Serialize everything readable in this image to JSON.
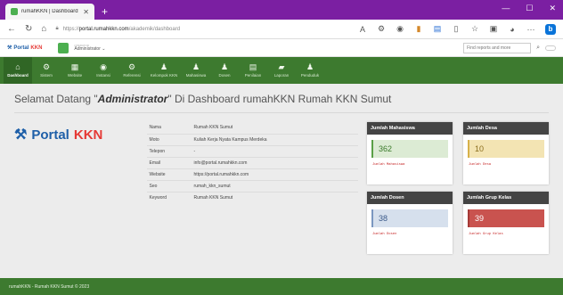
{
  "browser": {
    "tab_title": "rumahKKN | Dashboard",
    "new_tab": "+",
    "url_prefix": "https://",
    "url_host": "portal.rumahkkn.com",
    "url_path": "/akademik/dashboard"
  },
  "header": {
    "logo_portal": "Portal",
    "logo_kkn": "KKN",
    "user_role": "OPERATOR",
    "user_name": "Administrator",
    "search_placeholder": "Find reports and more"
  },
  "menu": [
    {
      "label": "Dashboard",
      "icon": "home-icon",
      "glyph": "⌂"
    },
    {
      "label": "Sistem",
      "icon": "gears-icon",
      "glyph": "⚙"
    },
    {
      "label": "Website",
      "icon": "chart-icon",
      "glyph": "▦"
    },
    {
      "label": "Instansi",
      "icon": "globe-icon",
      "glyph": "◉"
    },
    {
      "label": "Referensi",
      "icon": "gears-icon",
      "glyph": "⚙"
    },
    {
      "label": "Kelompok KKN",
      "icon": "group-icon",
      "glyph": "♟"
    },
    {
      "label": "Mahasiswa",
      "icon": "user-icon",
      "glyph": "♟"
    },
    {
      "label": "Dosen",
      "icon": "group-icon",
      "glyph": "♟"
    },
    {
      "label": "Penilaian",
      "icon": "table-icon",
      "glyph": "▤"
    },
    {
      "label": "Laporan",
      "icon": "book-icon",
      "glyph": "▰"
    },
    {
      "label": "Penduduk",
      "icon": "group-icon",
      "glyph": "♟"
    }
  ],
  "page": {
    "title_prefix": "Selamat Datang \"",
    "title_bold": "Administrator",
    "title_suffix": "\" Di Dashboard rumahKKN Rumah KKN Sumut"
  },
  "biglogo": {
    "portal": "Portal",
    "kkn": "KKN"
  },
  "info": [
    {
      "k": "Nama",
      "v": "Rumah KKN Sumut"
    },
    {
      "k": "Moto",
      "v": "Kuliah Kerja Nyata Kampus Merdeka"
    },
    {
      "k": "Telepon",
      "v": "-"
    },
    {
      "k": "Email",
      "v": "info@portal.rumahkkn.com"
    },
    {
      "k": "Website",
      "v": "https://portal.rumahkkn.com"
    },
    {
      "k": "Seo",
      "v": "rumah_kkn_sumut"
    },
    {
      "k": "Keyword",
      "v": "Rumah KKN Sumut"
    }
  ],
  "stats": [
    {
      "title": "Jumlah Mahasiswa",
      "value": "362",
      "label": "Jumlah Mahasiswa",
      "bg": "#dcebd4",
      "border": "#5aa046",
      "color": "#3a7a2a"
    },
    {
      "title": "Jumlah Desa",
      "value": "10",
      "label": "Jumlah Desa",
      "bg": "#f3e4b3",
      "border": "#d7b14a",
      "color": "#8a6d1d"
    },
    {
      "title": "Jumlah Dosen",
      "value": "38",
      "label": "Jumlah Dosen",
      "bg": "#d6e0ed",
      "border": "#7b97c0",
      "color": "#3b5a8a"
    },
    {
      "title": "Jumlah Grup Kelas",
      "value": "39",
      "label": "Jumlah Grup Kelas",
      "bg": "#c9534f",
      "border": "#a53a37",
      "color": "#ffffff"
    }
  ],
  "footer": "rumahKKN - Rumah KKN Sumut © 2023"
}
